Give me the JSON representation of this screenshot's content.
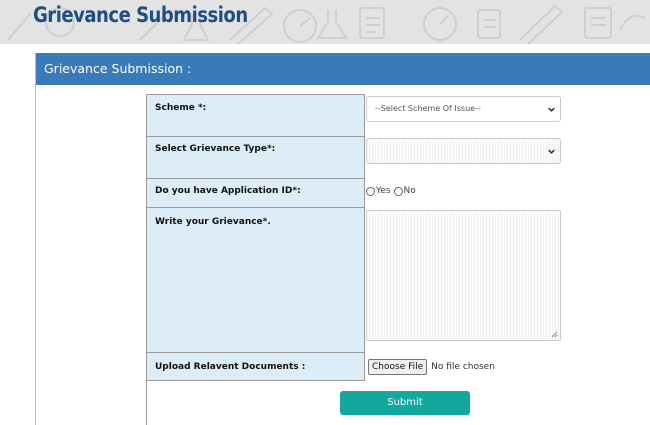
{
  "page": {
    "title": "Grievance Submission"
  },
  "panel": {
    "header": "Grievance Submission :"
  },
  "form": {
    "scheme_label": "Scheme *:",
    "scheme_select_value": "--Select Scheme Of Issue--",
    "grievance_type_label": "Select Grievance Type*:",
    "grievance_type_select_value": "",
    "application_id_label": "Do you have Application ID*:",
    "application_id_options": [
      "Yes",
      "No"
    ],
    "grievance_text_label": "Write your Grievance*.",
    "grievance_text_value": "",
    "upload_label": "Upload Relavent Documents :",
    "choose_file_label": "Choose File",
    "no_file_text": "No file chosen",
    "submit_label": "Submit"
  },
  "colors": {
    "title": "#1f4f82",
    "header_bg": "#3a7ab8",
    "label_bg": "#dcedf7",
    "submit_bg": "#13a89e"
  }
}
